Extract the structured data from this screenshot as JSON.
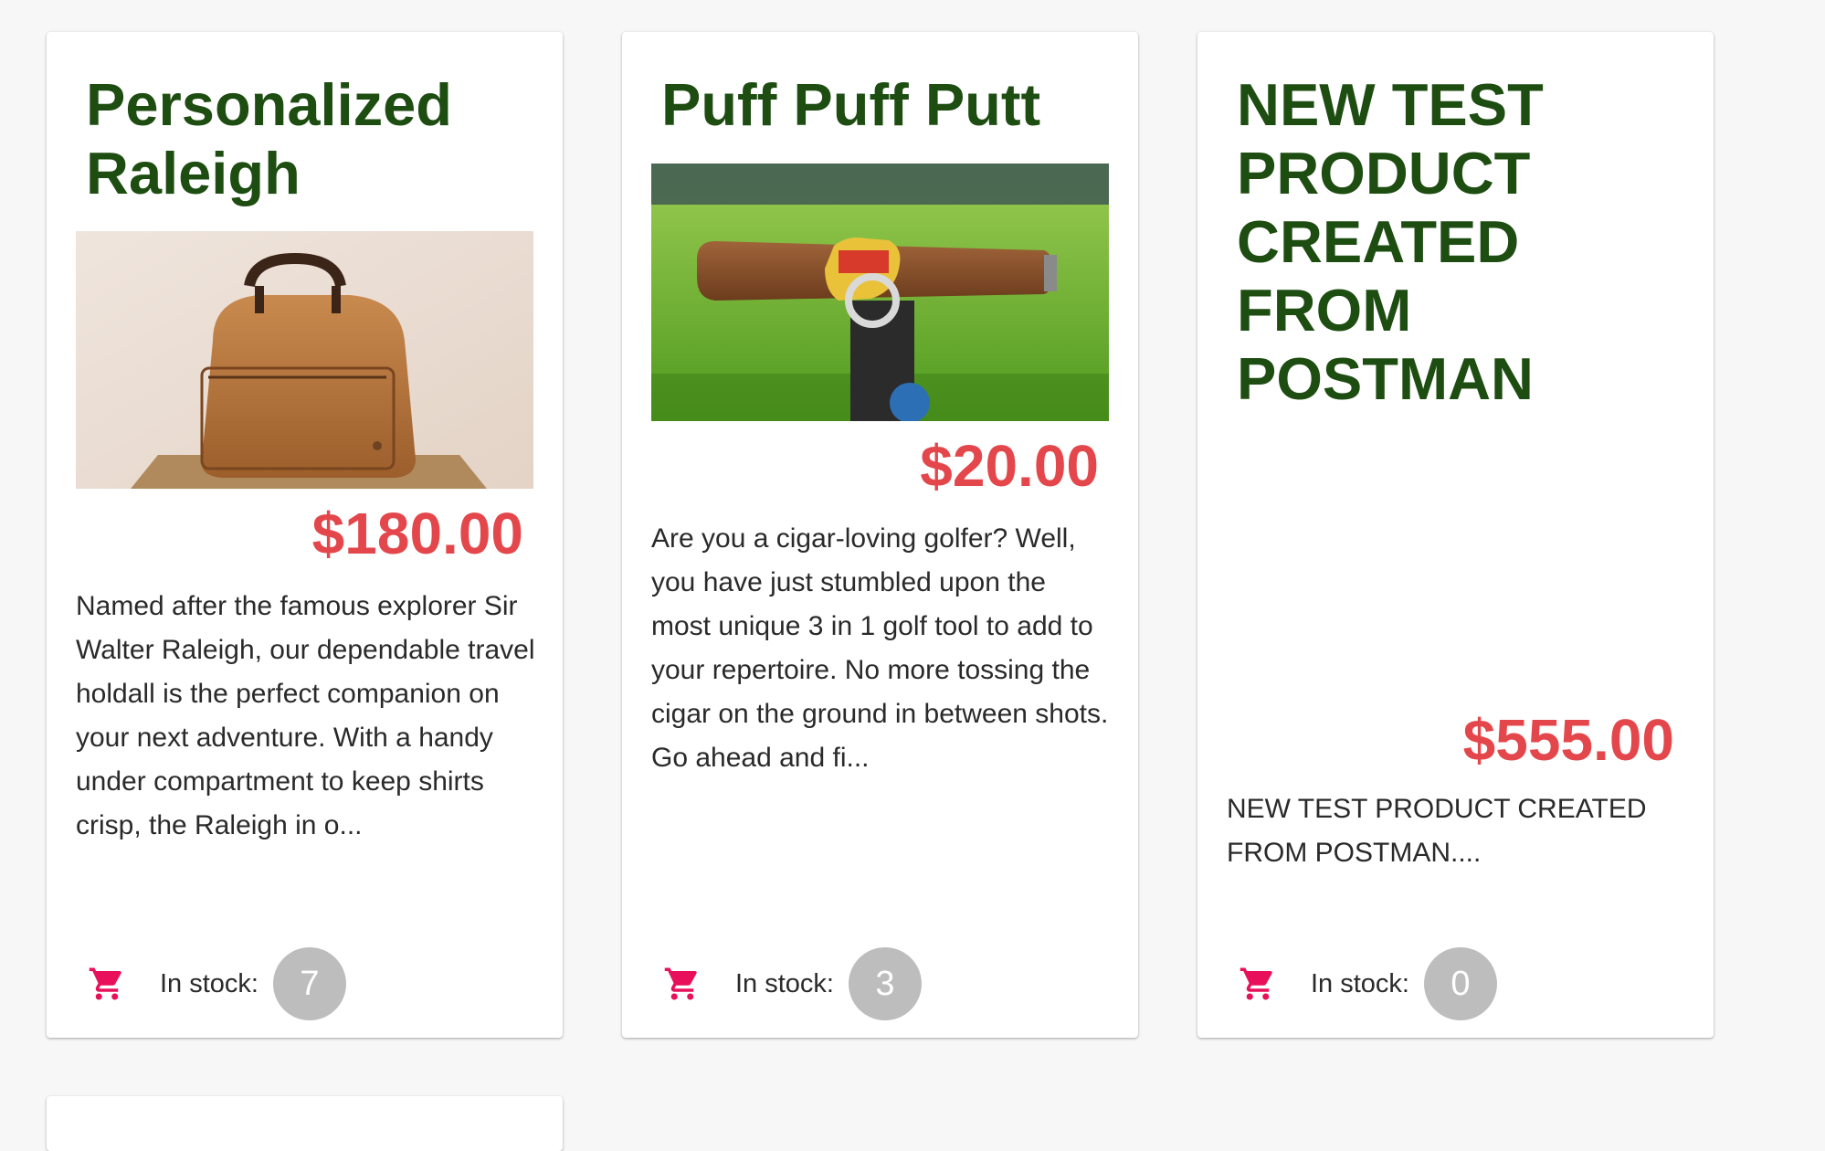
{
  "colors": {
    "title": "#1e4d12",
    "price": "#e4474b",
    "cart_icon": "#e8105a",
    "badge_bg": "#bdbdbd"
  },
  "products": [
    {
      "title": "Personalized Raleigh",
      "image_icon": "leather-holdall-bag-image",
      "price": "$180.00",
      "description": "Named after the famous explorer Sir Walter Raleigh, our dependable travel holdall is the perfect companion on your next adventure. With a handy under compartment to keep shirts crisp, the Raleigh in o...",
      "stock_label": "In stock:",
      "stock_count": "7",
      "cart_icon": "shopping-cart-icon"
    },
    {
      "title": "Puff Puff Putt",
      "image_icon": "cigar-golf-tool-image",
      "price": "$20.00",
      "description": "Are you a cigar-loving golfer? Well, you have just stumbled upon the most unique 3 in 1 golf tool to add to your repertoire. No more tossing the cigar on the ground in between shots. Go ahead and fi...",
      "stock_label": "In stock:",
      "stock_count": "3",
      "cart_icon": "shopping-cart-icon"
    },
    {
      "title": "NEW TEST PRODUCT CREATED FROM POSTMAN",
      "image_icon": "",
      "price": "$555.00",
      "description": "NEW TEST PRODUCT CREATED FROM POSTMAN....",
      "stock_label": "In stock:",
      "stock_count": "0",
      "cart_icon": "shopping-cart-icon"
    }
  ]
}
